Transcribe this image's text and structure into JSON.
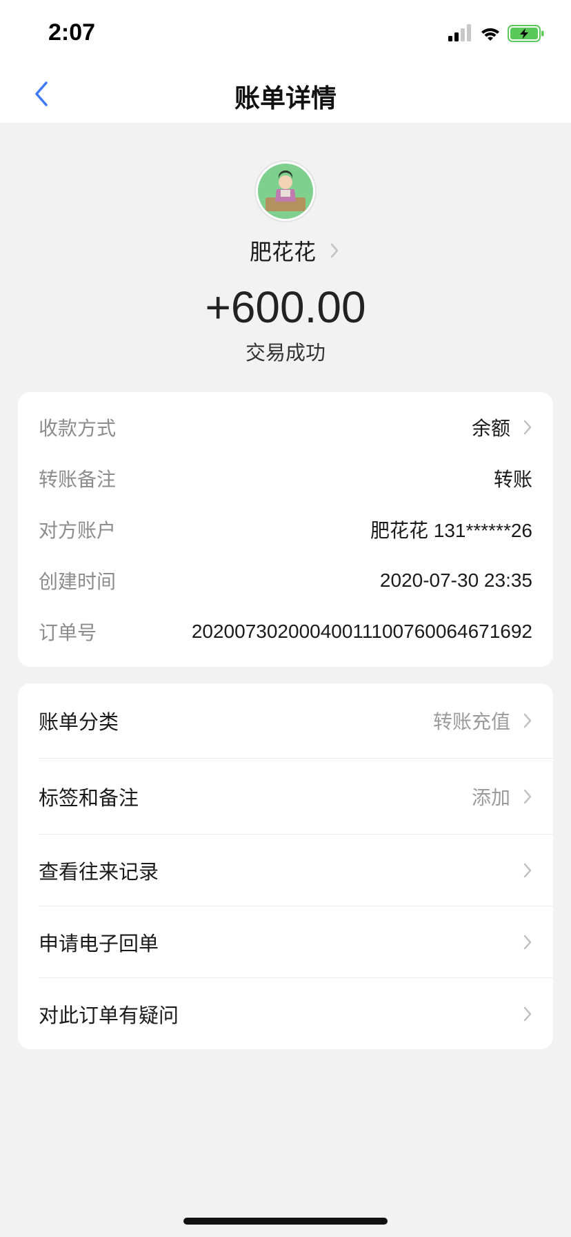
{
  "status_bar": {
    "time": "2:07"
  },
  "nav": {
    "title": "账单详情"
  },
  "profile": {
    "name": "肥花花",
    "amount": "+600.00",
    "status": "交易成功"
  },
  "details": [
    {
      "label": "收款方式",
      "value": "余额"
    },
    {
      "label": "转账备注",
      "value": "转账"
    },
    {
      "label": "对方账户",
      "value": "肥花花 131******26"
    },
    {
      "label": "创建时间",
      "value": "2020-07-30 23:35"
    },
    {
      "label": "订单号",
      "value": "2020073020004001110076006467​1692"
    }
  ],
  "actions": [
    {
      "label": "账单分类",
      "value": "转账充值"
    },
    {
      "label": "标签和备注",
      "value": "添加"
    },
    {
      "label": "查看往来记录",
      "value": ""
    },
    {
      "label": "申请电子回单",
      "value": ""
    },
    {
      "label": "对此订单有疑问",
      "value": ""
    }
  ],
  "colors": {
    "accent": "#3a7bf5",
    "battery": "#5ac95a",
    "page_bg": "#f2f2f2"
  }
}
